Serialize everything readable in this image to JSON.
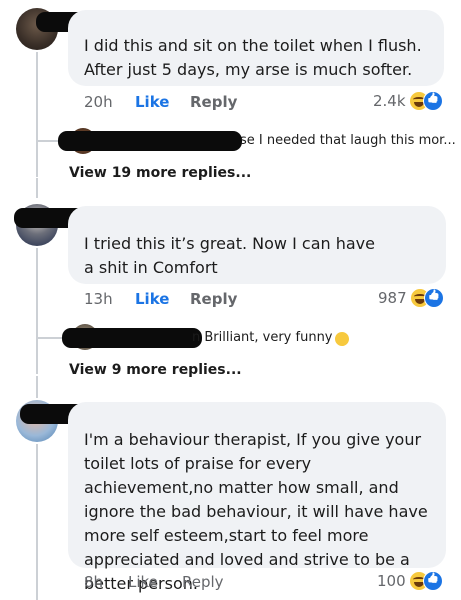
{
  "comments": [
    {
      "text": "I did this and sit on the toilet when I flush. After just 5 days, my arse is much softer.",
      "time": "20h",
      "like": "Like",
      "reply": "Reply",
      "count": "2.4k",
      "reply_preview": "se I needed that laugh this mor...",
      "view_more": "View 19 more replies..."
    },
    {
      "text": "I tried this it’s great. Now I can have a shit in Comfort",
      "time": "13h",
      "like": "Like",
      "reply": "Reply",
      "count": "987",
      "reply_preview": "n Brilliant, very funny",
      "view_more": "View 9 more replies..."
    },
    {
      "text": "I'm a behaviour therapist, If you give your toilet lots of praise for every achievement,no matter how small, and ignore the bad behaviour, it will have have more self esteem,start to feel more appreciated and loved and strive to be a better person.",
      "time": "8h",
      "like": "Like",
      "reply": "Reply",
      "count": "100"
    }
  ],
  "icons": {
    "reaction_haha": "haha-icon",
    "reaction_like": "like-icon",
    "emoji_laugh": "rofl-emoji"
  },
  "colors": {
    "bubble": "#f0f2f5",
    "meta": "#65676b",
    "like_blue": "#1b74e4",
    "haha_yellow": "#f7c93e"
  }
}
